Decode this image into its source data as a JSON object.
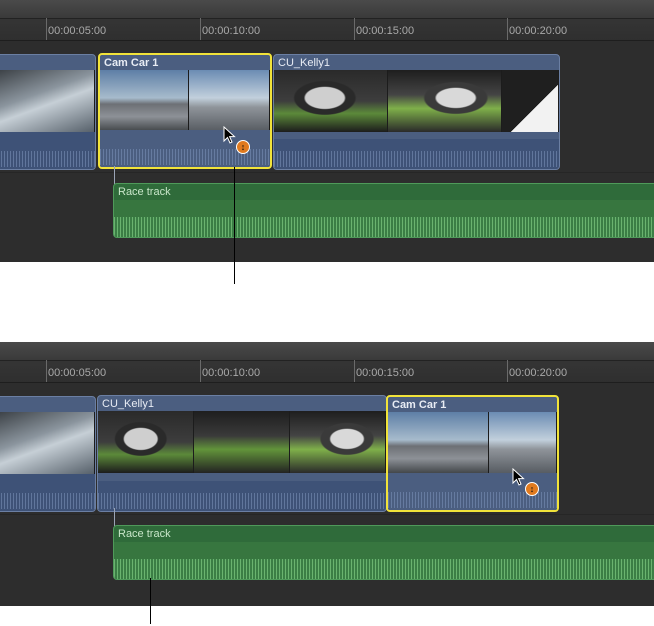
{
  "ruler": {
    "labels": [
      "00:00:05:00",
      "00:00:10:00",
      "00:00:15:00",
      "00:00:20:00"
    ]
  },
  "top": {
    "clip_selected": {
      "title": "Cam Car 1"
    },
    "clip_next": {
      "title": "CU_Kelly1"
    },
    "audio_clip": {
      "title": "Race track"
    }
  },
  "bottom": {
    "clip_first": {
      "title": "CU_Kelly1"
    },
    "clip_selected": {
      "title": "Cam Car 1"
    },
    "audio_clip": {
      "title": "Race track"
    }
  },
  "icons": {
    "pointer": "arrow-cursor-icon",
    "badge": "reposition-badge-icon"
  },
  "colors": {
    "selection": "#f1e33a",
    "video_clip": "#4b5e80",
    "audio_clip": "#2f6b3a",
    "badge": "#e07a1f"
  }
}
